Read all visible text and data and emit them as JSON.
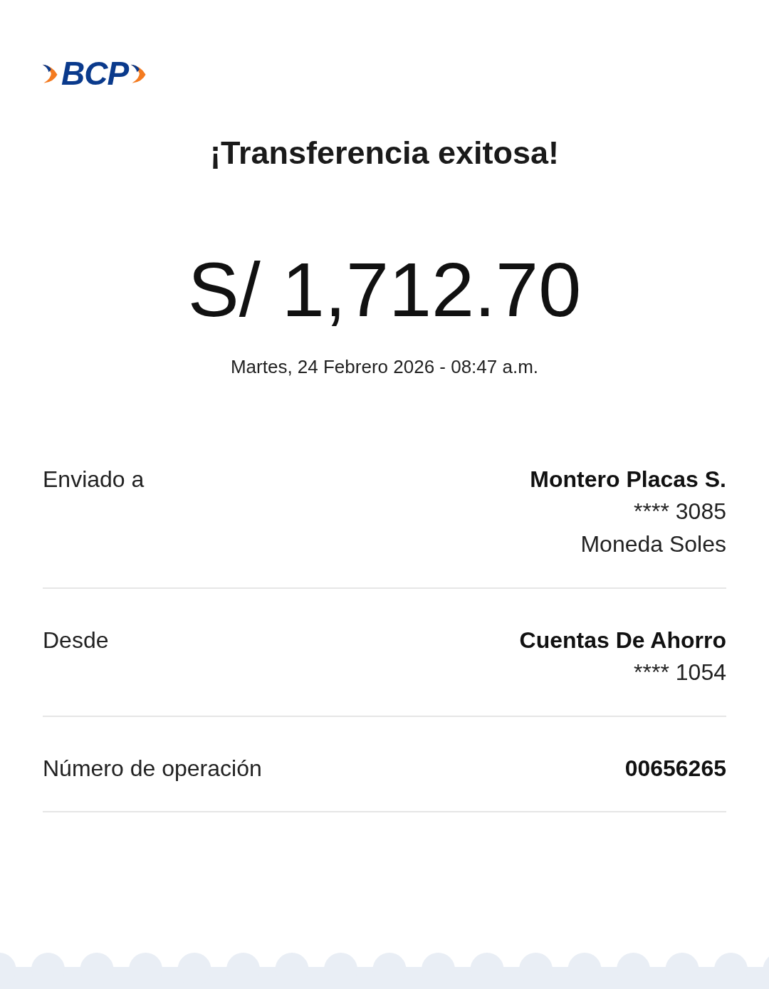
{
  "logo": {
    "text": "BCP"
  },
  "title": "¡Transferencia exitosa!",
  "amount": "S/ 1,712.70",
  "datetime": "Martes, 24 Febrero 2026 - 08:47 a.m.",
  "details": [
    {
      "label": "Enviado a",
      "value": "Montero Placas S.",
      "lines": [
        "**** 3085",
        "Moneda Soles"
      ]
    },
    {
      "label": "Desde",
      "value": "Cuentas De Ahorro",
      "lines": [
        "**** 1054"
      ]
    },
    {
      "label": "Número de operación",
      "value": "00656265"
    }
  ]
}
